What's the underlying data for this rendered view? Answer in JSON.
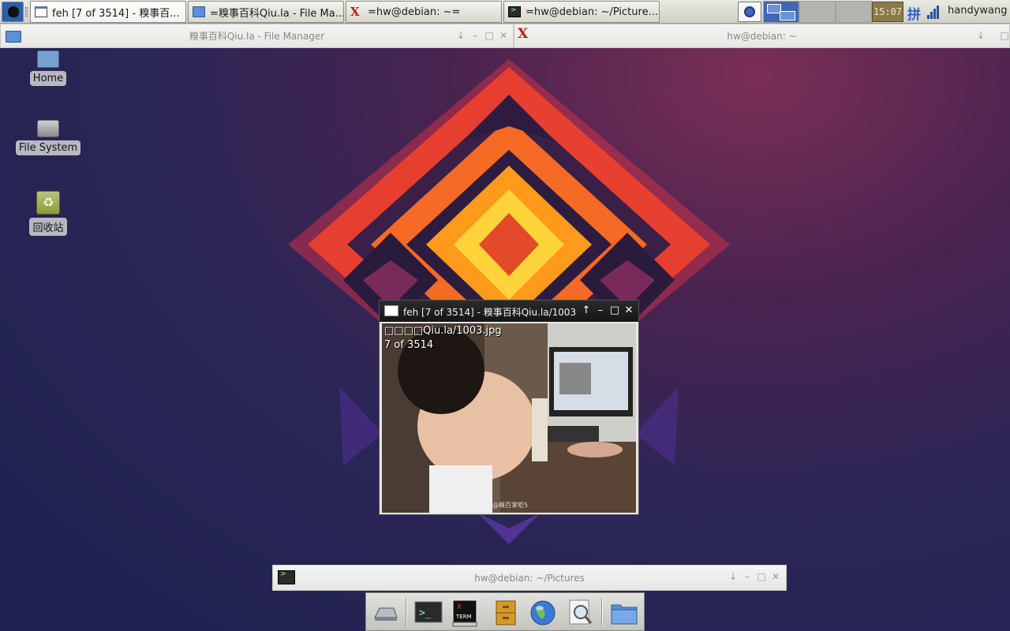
{
  "taskbar": {
    "tasks": [
      {
        "label": "feh [7 of 3514] - 糗事百..."
      },
      {
        "label": "=糗事百科Qiu.la - File Ma..."
      },
      {
        "label": "=hw@debian: ~="
      },
      {
        "label": "=hw@debian: ~/Picture..."
      }
    ],
    "clock": "15:07",
    "input_method": "拼",
    "username": "handywang"
  },
  "windows": {
    "file_manager_title": "糗事百科Qiu.la - File Manager",
    "terminal_top_title": "hw@debian: ~",
    "terminal_bottom_title": "hw@debian: ~/Pictures"
  },
  "desktop": {
    "icons": [
      {
        "label": "Home",
        "icon": "home-folder-icon"
      },
      {
        "label": "File System",
        "icon": "drive-icon"
      },
      {
        "label": "回收站",
        "icon": "trash-icon"
      }
    ]
  },
  "feh": {
    "title": "feh [7 of 3514] - 糗事百科Qiu.la/1003.jpg",
    "overlay_filename": "□□□□Qiu.la/1003.jpg",
    "overlay_counter": "7 of 3514",
    "watermark": "@糗百掌柜5"
  },
  "dock": {
    "items": [
      "network-drive-icon",
      "terminal-icon",
      "xterm-icon",
      "file-cabinet-icon",
      "web-browser-icon",
      "image-viewer-icon",
      "folder-icon"
    ]
  },
  "colors": {
    "panel": "#dcdcd6",
    "feh_titlebar": "#1e1e1e",
    "clock_bg": "#8a7a4a",
    "workspace_active": "#3f67b5"
  }
}
